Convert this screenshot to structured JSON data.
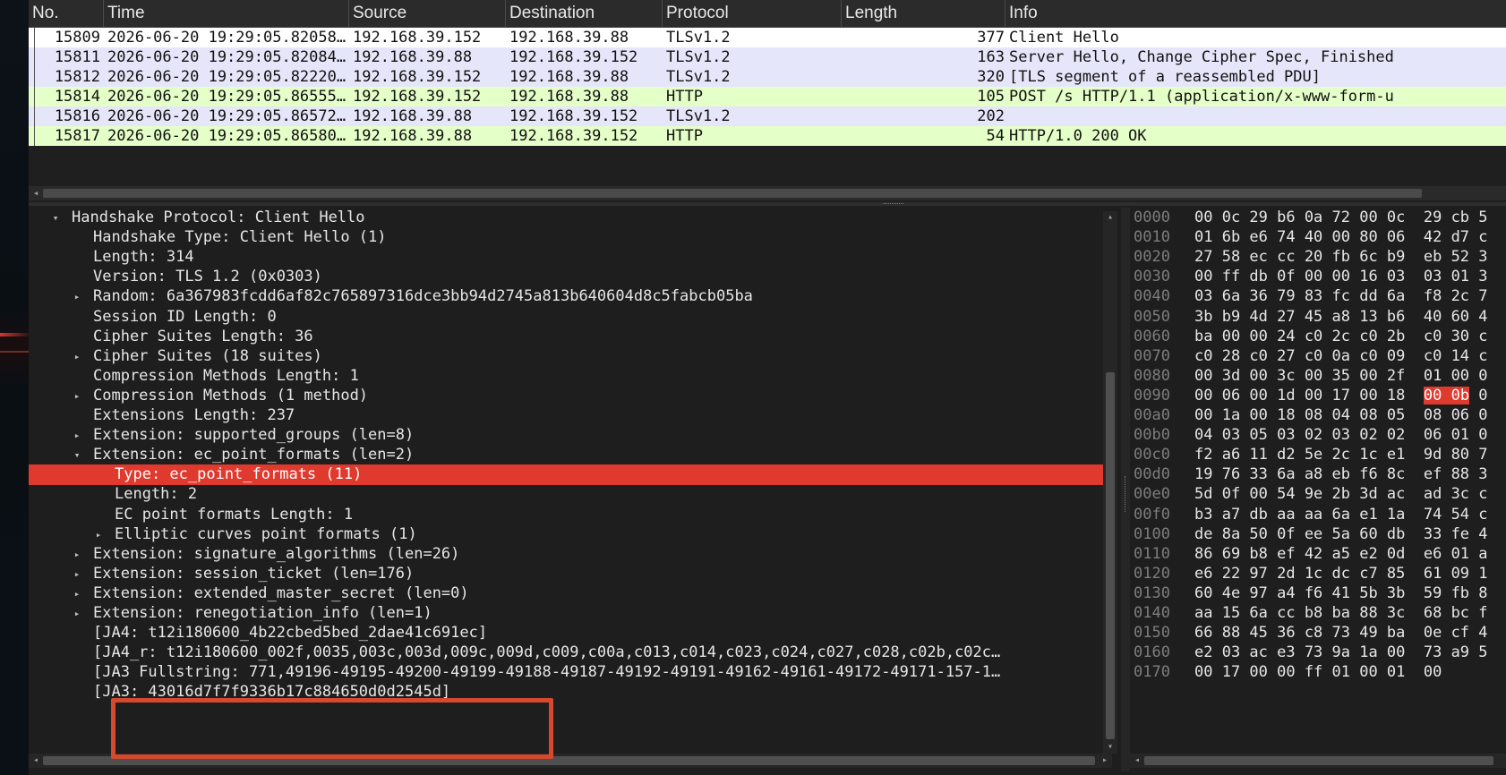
{
  "packet_list": {
    "columns": [
      "No.",
      "Time",
      "Source",
      "Destination",
      "Protocol",
      "Length",
      "Info"
    ],
    "rows": [
      {
        "no": "15809",
        "time": "2026-06-20 19:29:05.82058…",
        "src": "192.168.39.152",
        "dst": "192.168.39.88",
        "proto": "TLSv1.2",
        "len": "377",
        "info": "Client Hello",
        "bg": "#ffffff"
      },
      {
        "no": "15811",
        "time": "2026-06-20 19:29:05.82084…",
        "src": "192.168.39.88",
        "dst": "192.168.39.152",
        "proto": "TLSv1.2",
        "len": "163",
        "info": "Server Hello, Change Cipher Spec, Finished",
        "bg": "#e6e6fa"
      },
      {
        "no": "15812",
        "time": "2026-06-20 19:29:05.82220…",
        "src": "192.168.39.152",
        "dst": "192.168.39.88",
        "proto": "TLSv1.2",
        "len": "320",
        "info": "[TLS segment of a reassembled PDU]",
        "bg": "#e6e6fa"
      },
      {
        "no": "15814",
        "time": "2026-06-20 19:29:05.86555…",
        "src": "192.168.39.152",
        "dst": "192.168.39.88",
        "proto": "HTTP",
        "len": "105",
        "info": "POST /s HTTP/1.1  (application/x-www-form-u",
        "bg": "#e4ffc7"
      },
      {
        "no": "15816",
        "time": "2026-06-20 19:29:05.86572…",
        "src": "192.168.39.88",
        "dst": "192.168.39.152",
        "proto": "TLSv1.2",
        "len": "202",
        "info": "",
        "bg": "#e6e6fa"
      },
      {
        "no": "15817",
        "time": "2026-06-20 19:29:05.86580…",
        "src": "192.168.39.88",
        "dst": "192.168.39.152",
        "proto": "HTTP",
        "len": "54",
        "info": "HTTP/1.0 200 OK",
        "bg": "#e4ffc7"
      }
    ]
  },
  "details": {
    "lines": [
      {
        "level": 0,
        "twisty": "expanded",
        "text": "Handshake Protocol: Client Hello"
      },
      {
        "level": 1,
        "twisty": "",
        "text": "Handshake Type: Client Hello (1)"
      },
      {
        "level": 1,
        "twisty": "",
        "text": "Length: 314"
      },
      {
        "level": 1,
        "twisty": "",
        "text": "Version: TLS 1.2 (0x0303)"
      },
      {
        "level": 1,
        "twisty": "collapsed",
        "text": "Random: 6a367983fcdd6af82c765897316dce3bb94d2745a813b640604d8c5fabcb05ba"
      },
      {
        "level": 1,
        "twisty": "",
        "text": "Session ID Length: 0"
      },
      {
        "level": 1,
        "twisty": "",
        "text": "Cipher Suites Length: 36"
      },
      {
        "level": 1,
        "twisty": "collapsed",
        "text": "Cipher Suites (18 suites)"
      },
      {
        "level": 1,
        "twisty": "",
        "text": "Compression Methods Length: 1"
      },
      {
        "level": 1,
        "twisty": "collapsed",
        "text": "Compression Methods (1 method)"
      },
      {
        "level": 1,
        "twisty": "",
        "text": "Extensions Length: 237"
      },
      {
        "level": 1,
        "twisty": "collapsed",
        "text": "Extension: supported_groups (len=8)"
      },
      {
        "level": 1,
        "twisty": "expanded",
        "text": "Extension: ec_point_formats (len=2)"
      },
      {
        "level": 2,
        "twisty": "",
        "text": "Type: ec_point_formats (11)",
        "selected": true
      },
      {
        "level": 2,
        "twisty": "",
        "text": "Length: 2"
      },
      {
        "level": 2,
        "twisty": "",
        "text": "EC point formats Length: 1"
      },
      {
        "level": 2,
        "twisty": "collapsed",
        "text": "Elliptic curves point formats (1)"
      },
      {
        "level": 1,
        "twisty": "collapsed",
        "text": "Extension: signature_algorithms (len=26)"
      },
      {
        "level": 1,
        "twisty": "collapsed",
        "text": "Extension: session_ticket (len=176)"
      },
      {
        "level": 1,
        "twisty": "collapsed",
        "text": "Extension: extended_master_secret (len=0)"
      },
      {
        "level": 1,
        "twisty": "collapsed",
        "text": "Extension: renegotiation_info (len=1)"
      },
      {
        "level": 1,
        "twisty": "",
        "text": "[JA4: t12i180600_4b22cbed5bed_2dae41c691ec]"
      },
      {
        "level": 1,
        "twisty": "",
        "text": "[JA4_r: t12i180600_002f,0035,003c,003d,009c,009d,c009,c00a,c013,c014,c023,c024,c027,c028,c02b,c02c…"
      },
      {
        "level": 1,
        "twisty": "",
        "text": "[JA3 Fullstring: 771,49196-49195-49200-49199-49188-49187-49192-49191-49162-49161-49172-49171-157-1…"
      },
      {
        "level": 1,
        "twisty": "",
        "text": "[JA3: 43016d7f7f9336b17c884650d0d2545d]"
      }
    ]
  },
  "bytes": {
    "rows": [
      {
        "off": "0000",
        "hex": "00 0c 29 b6 0a 72 00 0c  29 cb 5"
      },
      {
        "off": "0010",
        "hex": "01 6b e6 74 40 00 80 06  42 d7 c"
      },
      {
        "off": "0020",
        "hex": "27 58 ec cc 20 fb 6c b9  eb 52 3"
      },
      {
        "off": "0030",
        "hex": "00 ff db 0f 00 00 16 03  03 01 3"
      },
      {
        "off": "0040",
        "hex": "03 6a 36 79 83 fc dd 6a  f8 2c 7"
      },
      {
        "off": "0050",
        "hex": "3b b9 4d 27 45 a8 13 b6  40 60 4"
      },
      {
        "off": "0060",
        "hex": "ba 00 00 24 c0 2c c0 2b  c0 30 c"
      },
      {
        "off": "0070",
        "hex": "c0 28 c0 27 c0 0a c0 09  c0 14 c"
      },
      {
        "off": "0080",
        "hex": "00 3d 00 3c 00 35 00 2f  01 00 0"
      },
      {
        "off": "0090",
        "hex_pre": "00 06 00 1d 00 17 00 18  ",
        "hex_hl": "00 0b",
        "hex_post": " 0"
      },
      {
        "off": "00a0",
        "hex": "00 1a 00 18 08 04 08 05  08 06 0"
      },
      {
        "off": "00b0",
        "hex": "04 03 05 03 02 03 02 02  06 01 0"
      },
      {
        "off": "00c0",
        "hex": "f2 a6 11 d2 5e 2c 1c e1  9d 80 7"
      },
      {
        "off": "00d0",
        "hex": "19 76 33 6a a8 eb f6 8c  ef 88 3"
      },
      {
        "off": "00e0",
        "hex": "5d 0f 00 54 9e 2b 3d ac  ad 3c c"
      },
      {
        "off": "00f0",
        "hex": "b3 a7 db aa aa 6a e1 1a  74 54 c"
      },
      {
        "off": "0100",
        "hex": "de 8a 50 0f ee 5a 60 db  33 fe 4"
      },
      {
        "off": "0110",
        "hex": "86 69 b8 ef 42 a5 e2 0d  e6 01 a"
      },
      {
        "off": "0120",
        "hex": "e6 22 97 2d 1c dc c7 85  61 09 1"
      },
      {
        "off": "0130",
        "hex": "60 4e 97 a4 f6 41 5b 3b  59 fb 8"
      },
      {
        "off": "0140",
        "hex": "aa 15 6a cc b8 ba 88 3c  68 bc f"
      },
      {
        "off": "0150",
        "hex": "66 88 45 36 c8 73 49 ba  0e cf 4"
      },
      {
        "off": "0160",
        "hex": "e2 03 ac e3 73 9a 1a 00  73 a9 5"
      },
      {
        "off": "0170",
        "hex": "00 17 00 00 ff 01 00 01  00"
      }
    ]
  },
  "colors": {
    "selection": "#e03a2f",
    "annotation_box": "#d6492e",
    "tls_row": "#e6e6fa",
    "http_row": "#e4ffc7"
  },
  "icons": {
    "expanded": "triangle-down-icon",
    "collapsed": "triangle-right-icon"
  }
}
